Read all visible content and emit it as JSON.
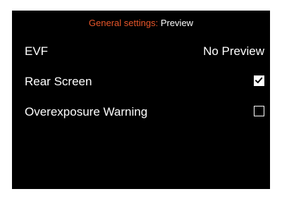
{
  "header": {
    "category": "General settings:",
    "page": "Preview",
    "category_color": "#e8562a"
  },
  "settings": [
    {
      "label": "EVF",
      "value": "No Preview"
    },
    {
      "label": "Rear Screen",
      "checked": true
    },
    {
      "label": "Overexposure Warning",
      "checked": false
    }
  ]
}
